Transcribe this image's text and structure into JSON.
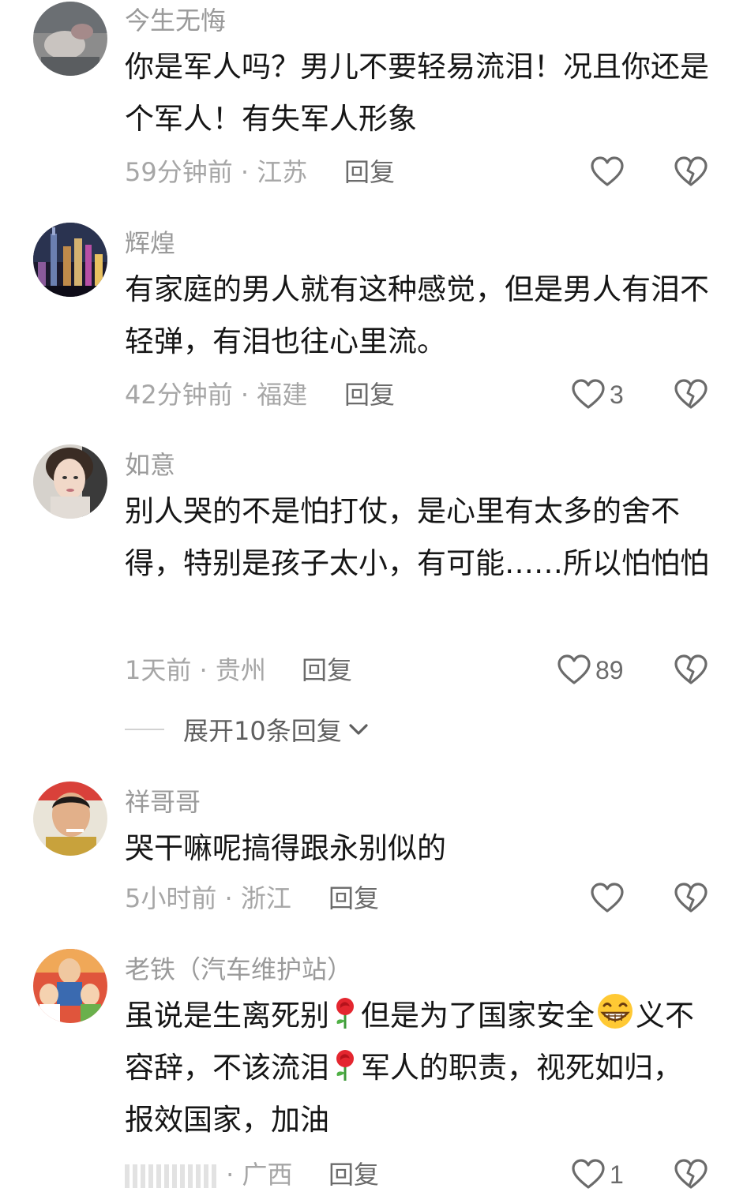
{
  "comments": [
    {
      "username": "今生无悔",
      "text": "你是军人吗？男儿不要轻易流泪！况且你还是个军人！有失军人形象",
      "time": "59分钟前",
      "location": "江苏",
      "reply_label": "回复",
      "likes": "",
      "avatar_icon": "avatar-photo"
    },
    {
      "username": "辉煌",
      "text": "有家庭的男人就有这种感觉，但是男人有泪不轻弹，有泪也往心里流。",
      "time": "42分钟前",
      "location": "福建",
      "reply_label": "回复",
      "likes": "3",
      "avatar_icon": "avatar-city-night"
    },
    {
      "username": "如意",
      "text": "别人哭的不是怕打仗，是心里有太多的舍不得，特别是孩子太小，有可能……所以怕怕怕",
      "time": "1天前",
      "location": "贵州",
      "reply_label": "回复",
      "likes": "89",
      "avatar_icon": "avatar-woman"
    },
    {
      "username": "祥哥哥",
      "text": "哭干嘛呢搞得跟永别似的",
      "time": "5小时前",
      "location": "浙江",
      "reply_label": "回复",
      "likes": "",
      "avatar_icon": "avatar-man"
    },
    {
      "username": "老铁（汽车维护站）",
      "text_parts": [
        "虽说是生离死别",
        "但是为了国家安全",
        "义不容辞，不该流泪",
        "军人的职责，视死如归，报效国家，加油"
      ],
      "emojis": [
        "rose-emoji",
        "grin-emoji",
        "rose-emoji"
      ],
      "time": "",
      "location": "广西",
      "reply_label": "回复",
      "likes": "1",
      "avatar_icon": "avatar-family"
    }
  ],
  "expand_replies_label": "展开10条回复",
  "colors": {
    "text": "#161616",
    "meta": "#a6a6a6",
    "username": "#9a9a9a"
  }
}
